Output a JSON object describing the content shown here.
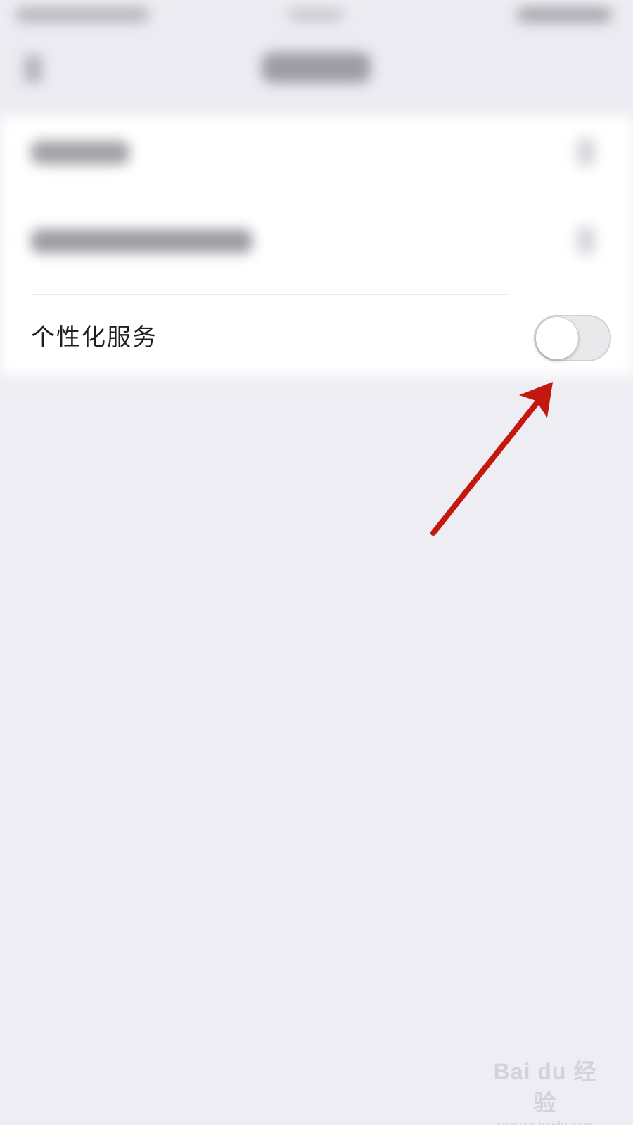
{
  "settings": {
    "personalized_service": {
      "label": "个性化服务",
      "enabled": false
    }
  },
  "watermark": {
    "logo": "Bai du 经验",
    "url": "jingyan.baidu.com"
  },
  "annotation": {
    "arrow_color": "#c4180e"
  },
  "colors": {
    "background": "#eeedf3",
    "toggle_off_track": "#e9e9ec"
  }
}
